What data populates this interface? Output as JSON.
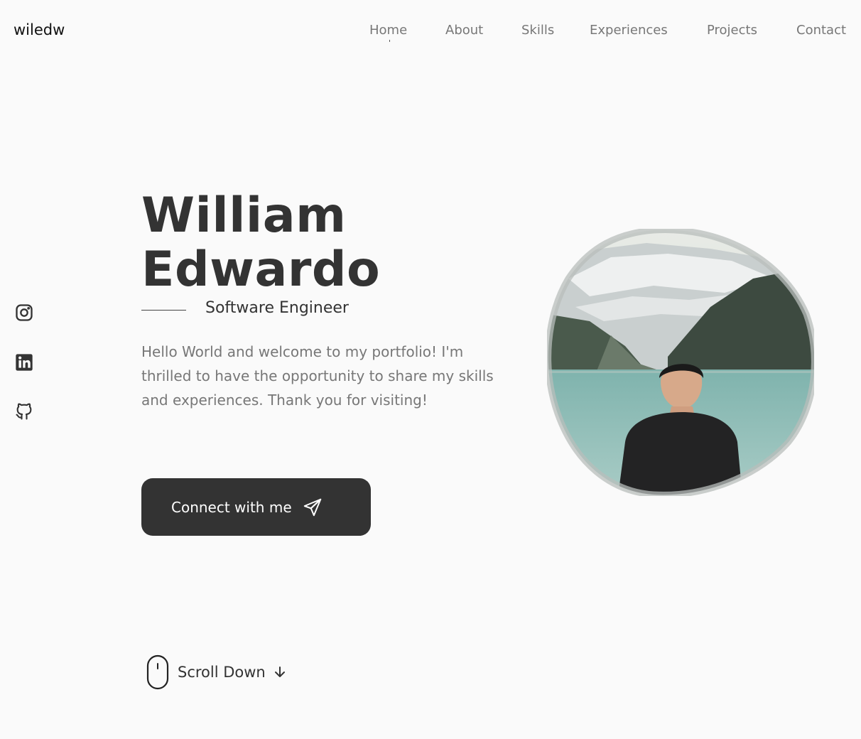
{
  "header": {
    "logo": "wiledw",
    "nav": [
      {
        "label": "Home"
      },
      {
        "label": "About"
      },
      {
        "label": "Skills"
      },
      {
        "label": "Experiences"
      },
      {
        "label": "Projects"
      },
      {
        "label": "Contact"
      }
    ]
  },
  "socials": [
    {
      "icon": "instagram-icon"
    },
    {
      "icon": "linkedin-icon"
    },
    {
      "icon": "github-icon"
    }
  ],
  "hero": {
    "first_name": "William",
    "last_name": "Edwardo",
    "role": "Software Engineer",
    "intro": "Hello World and welcome to my portfolio! I'm thrilled to have the opportunity to share my skills and experiences. Thank you for visiting!",
    "cta_label": "Connect with me",
    "cta_icon": "send-icon"
  },
  "photo": {
    "alt": "profile-photo"
  },
  "scroll": {
    "label": "Scroll Down",
    "icon": "mouse-icon",
    "arrow": "arrow-down-icon"
  },
  "colors": {
    "background": "#fafafa",
    "text": "#333333",
    "muted": "#777777",
    "button": "#333333"
  }
}
